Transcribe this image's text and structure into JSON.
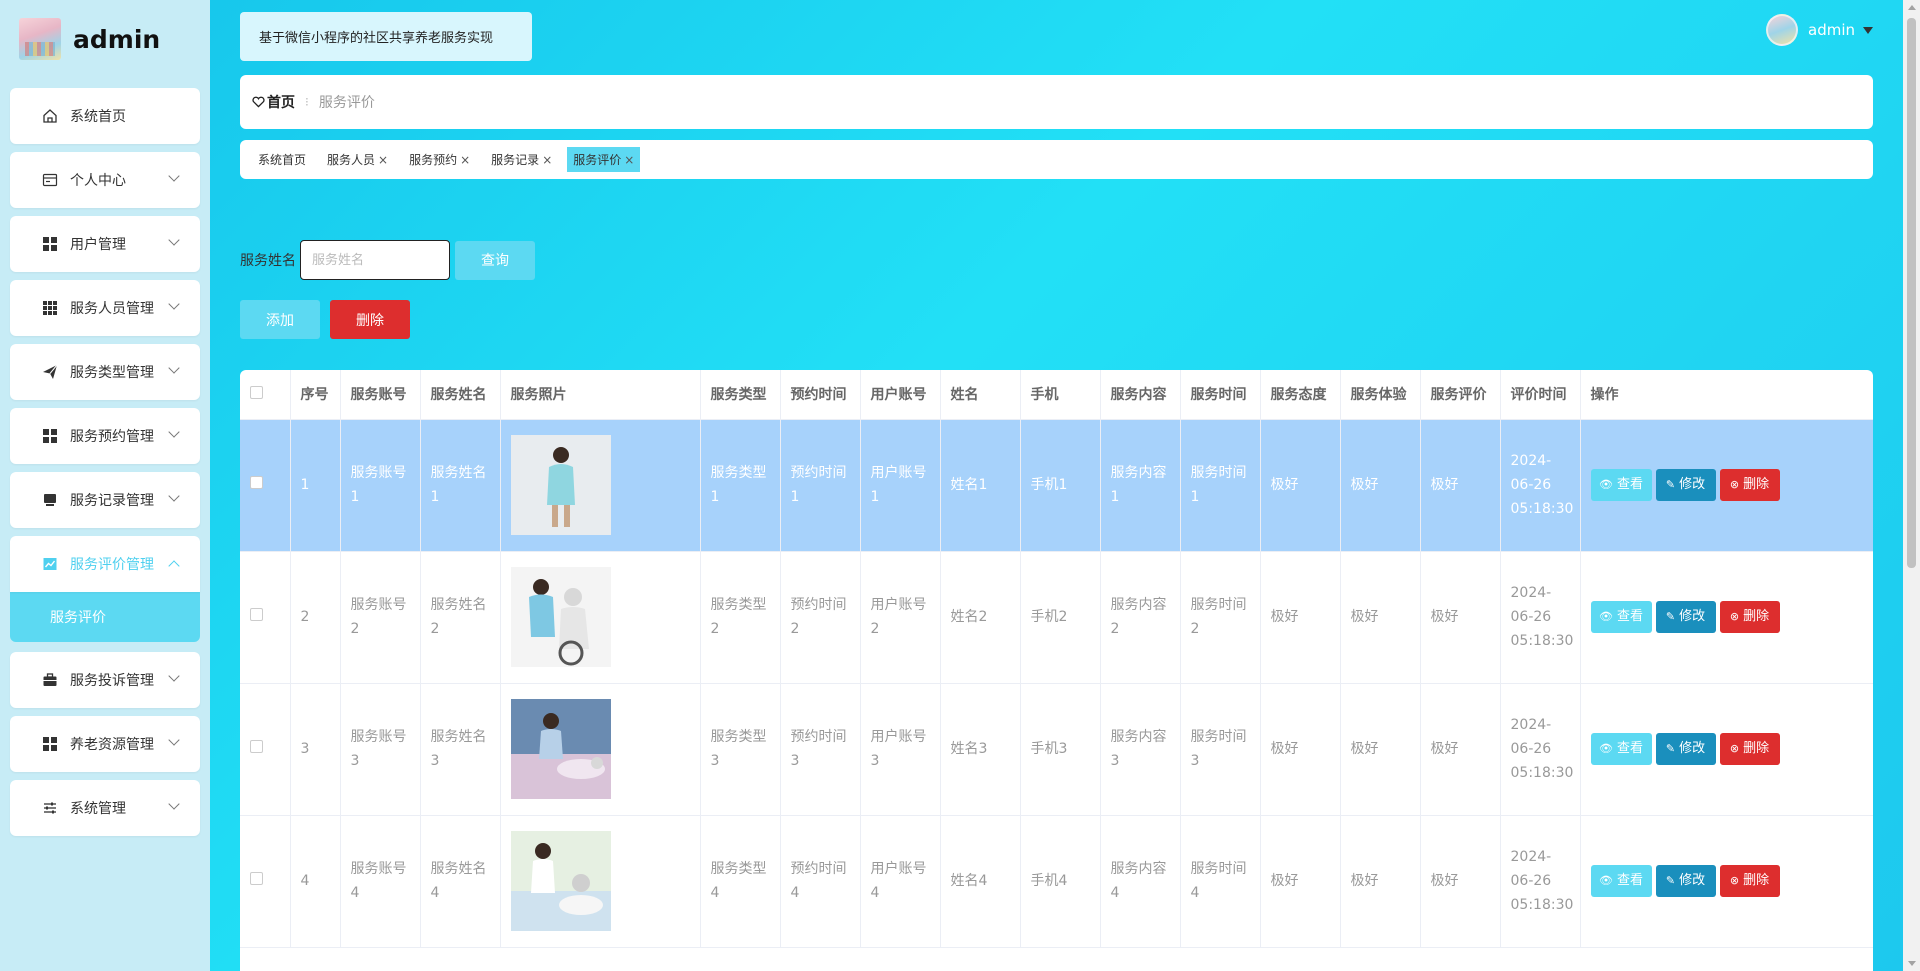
{
  "brand": {
    "name": "admin"
  },
  "sidebar": {
    "items": [
      {
        "label": "系统首页",
        "icon": "home-icon"
      },
      {
        "label": "个人中心",
        "icon": "calendar-icon"
      },
      {
        "label": "用户管理",
        "icon": "grid-icon"
      },
      {
        "label": "服务人员管理",
        "icon": "grid9-icon"
      },
      {
        "label": "服务类型管理",
        "icon": "send-icon"
      },
      {
        "label": "服务预约管理",
        "icon": "grid-icon"
      },
      {
        "label": "服务记录管理",
        "icon": "monitor-icon"
      },
      {
        "label": "服务评价管理",
        "icon": "chart-icon"
      },
      {
        "label": "服务投诉管理",
        "icon": "briefcase-icon"
      },
      {
        "label": "养老资源管理",
        "icon": "grid-icon"
      },
      {
        "label": "系统管理",
        "icon": "sliders-icon"
      }
    ],
    "submenu_label": "服务评价"
  },
  "header": {
    "title": "基于微信小程序的社区共享养老服务实现",
    "user": "admin"
  },
  "breadcrumb": {
    "home": "首页",
    "separator": "⁝",
    "current": "服务评价"
  },
  "tags": [
    {
      "label": "系统首页",
      "closable": false
    },
    {
      "label": "服务人员",
      "closable": true
    },
    {
      "label": "服务预约",
      "closable": true
    },
    {
      "label": "服务记录",
      "closable": true
    },
    {
      "label": "服务评价",
      "closable": true
    }
  ],
  "search": {
    "label": "服务姓名",
    "placeholder": "服务姓名",
    "button": "查询"
  },
  "actions": {
    "add": "添加",
    "delete": "删除"
  },
  "table": {
    "headers": [
      "序号",
      "服务账号",
      "服务姓名",
      "服务照片",
      "服务类型",
      "预约时间",
      "用户账号",
      "姓名",
      "手机",
      "服务内容",
      "服务时间",
      "服务态度",
      "服务体验",
      "服务评价",
      "评价时间",
      "操作"
    ],
    "op_labels": {
      "view": "查看",
      "edit": "修改",
      "delete": "删除"
    },
    "rows": [
      {
        "no": "1",
        "account": "服务账号1",
        "name": "服务姓名1",
        "type": "服务类型1",
        "appt": "预约时间1",
        "user": "用户账号1",
        "uname": "姓名1",
        "phone": "手机1",
        "content": "服务内容1",
        "stime": "服务时间1",
        "attitude": "极好",
        "experience": "极好",
        "rating": "极好",
        "rtime": "2024-06-26 05:18:30"
      },
      {
        "no": "2",
        "account": "服务账号2",
        "name": "服务姓名2",
        "type": "服务类型2",
        "appt": "预约时间2",
        "user": "用户账号2",
        "uname": "姓名2",
        "phone": "手机2",
        "content": "服务内容2",
        "stime": "服务时间2",
        "attitude": "极好",
        "experience": "极好",
        "rating": "极好",
        "rtime": "2024-06-26 05:18:30"
      },
      {
        "no": "3",
        "account": "服务账号3",
        "name": "服务姓名3",
        "type": "服务类型3",
        "appt": "预约时间3",
        "user": "用户账号3",
        "uname": "姓名3",
        "phone": "手机3",
        "content": "服务内容3",
        "stime": "服务时间3",
        "attitude": "极好",
        "experience": "极好",
        "rating": "极好",
        "rtime": "2024-06-26 05:18:30"
      },
      {
        "no": "4",
        "account": "服务账号4",
        "name": "服务姓名4",
        "type": "服务类型4",
        "appt": "预约时间4",
        "user": "用户账号4",
        "uname": "姓名4",
        "phone": "手机4",
        "content": "服务内容4",
        "stime": "服务时间4",
        "attitude": "极好",
        "experience": "极好",
        "rating": "极好",
        "rtime": "2024-06-26 05:18:30"
      }
    ]
  },
  "colors": {
    "accent": "#5cd9f2",
    "edit": "#1a8fbd",
    "danger": "#dd2e2e",
    "selected_row": "#a7d2fb"
  }
}
